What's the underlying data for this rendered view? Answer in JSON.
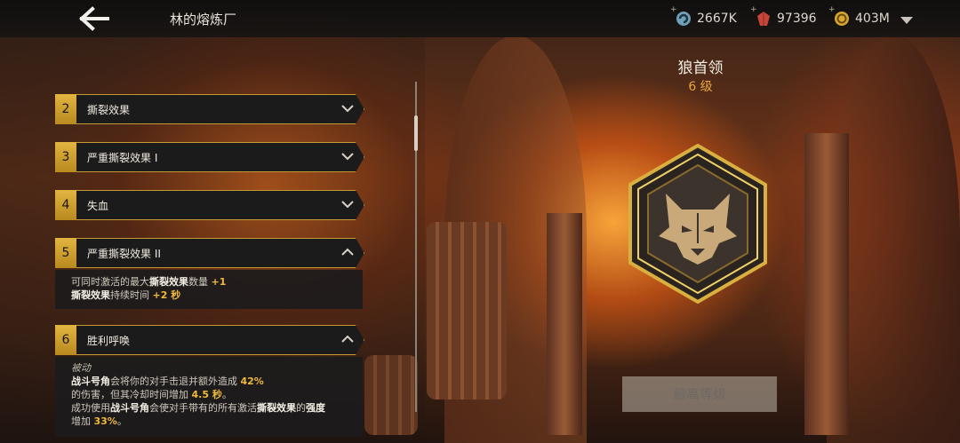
{
  "header": {
    "title": "林的熔炼厂",
    "resources": [
      {
        "icon": "gear-swirl-icon",
        "value": "2667K",
        "plus": "+"
      },
      {
        "icon": "red-gem-icon",
        "value": "97396",
        "plus": "+"
      },
      {
        "icon": "gold-coin-icon",
        "value": "403M",
        "plus": "+"
      }
    ]
  },
  "skills": [
    {
      "num": "2",
      "label": "撕裂效果",
      "expanded": false
    },
    {
      "num": "3",
      "label": "严重撕裂效果 I",
      "expanded": false
    },
    {
      "num": "4",
      "label": "失血",
      "expanded": false
    },
    {
      "num": "5",
      "label": "严重撕裂效果 II",
      "expanded": true,
      "desc": {
        "line1_pre": "可同时激活的最大",
        "line1_b": "撕裂效果",
        "line1_mid": "数量 ",
        "line1_val": "+1",
        "line2_b": "撕裂效果",
        "line2_mid": "持续时间 ",
        "line2_val": "+2 秒"
      }
    },
    {
      "num": "6",
      "label": "胜利呼唤",
      "expanded": true,
      "desc": {
        "passive": "被动",
        "l1_b": "战斗号角",
        "l1_mid": "会将你的对手击退并额外造成 ",
        "l1_val": "42%",
        "l2_mid": "的伤害，但其冷却时间增加 ",
        "l2_val": "4.5 秒",
        "l2_end": "。",
        "l3_pre": "成功使用",
        "l3_b1": "战斗号角",
        "l3_mid": "会使对手带有的所有激活",
        "l3_b2": "撕裂效果",
        "l3_mid2": "的",
        "l3_b3": "强度",
        "l4_pre": "增加 ",
        "l4_val": "33%",
        "l4_end": "。"
      }
    }
  ],
  "rank": {
    "title": "狼首领",
    "level": "6 级",
    "emblem_icon": "wolf-head-icon",
    "button_label": "最高等级"
  },
  "colors": {
    "accent_gold": "#c59a34",
    "highlight": "#f0b93a",
    "level": "#e9a53a"
  }
}
